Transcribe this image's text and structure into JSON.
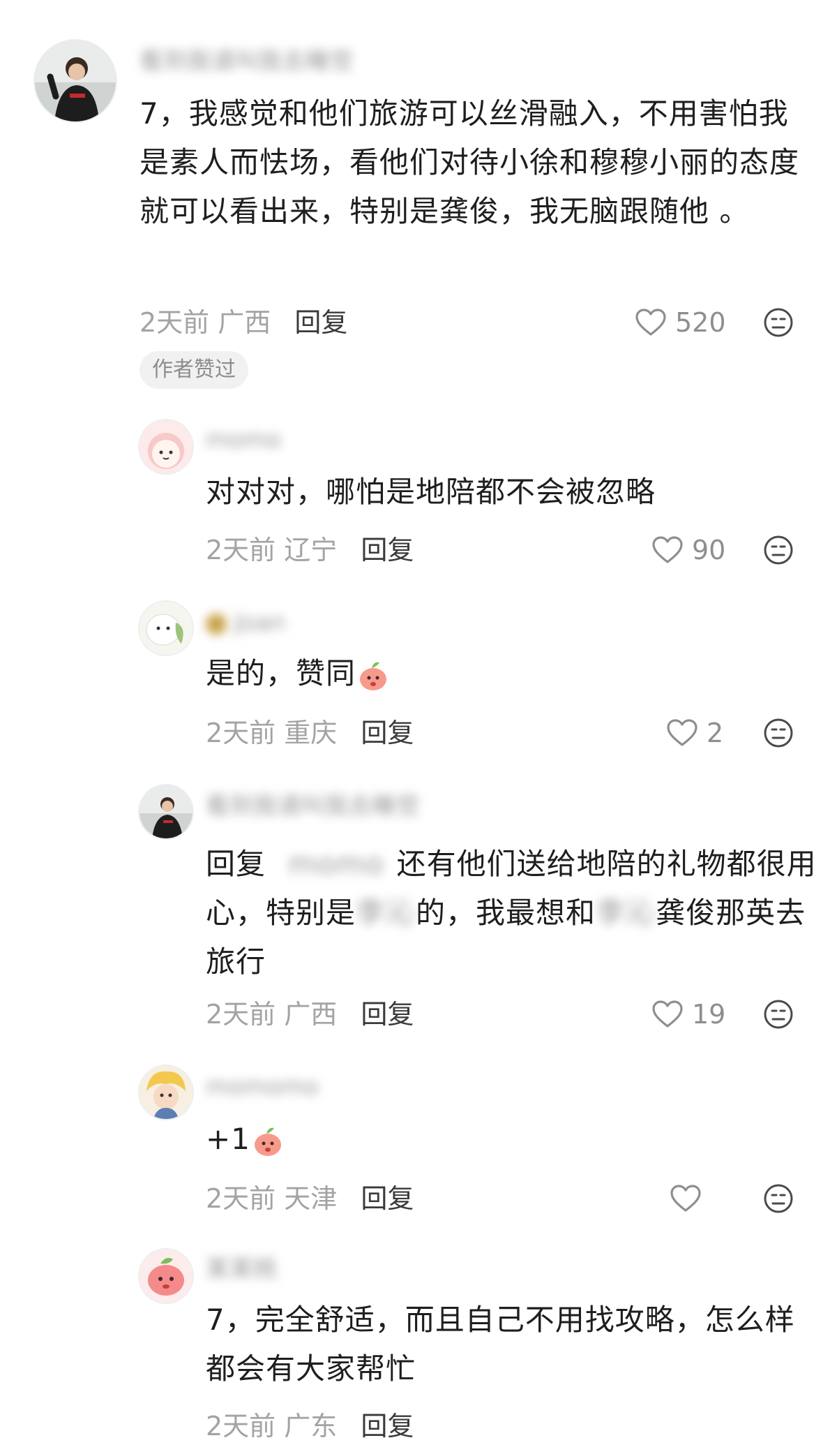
{
  "comments": [
    {
      "username": "看到我请叫我去睡觉",
      "text": "7，我感觉和他们旅游可以丝滑融入，不用害怕我是素人而怯场，看他们对待小徐和穆穆小丽的态度就可以看出来，特别是龚俊，我无脑跟随他 。",
      "time": "2天前",
      "location": "广西",
      "reply_label": "回复",
      "likes": "520",
      "badge": "作者赞过"
    },
    {
      "username": "momo",
      "text": "对对对，哪怕是地陪都不会被忽略",
      "time": "2天前",
      "location": "辽宁",
      "reply_label": "回复",
      "likes": "90"
    },
    {
      "username": "Joan",
      "text": "是的，赞同",
      "time": "2天前",
      "location": "重庆",
      "reply_label": "回复",
      "likes": "2"
    },
    {
      "username": "看到我请叫我去睡觉",
      "reply_prefix": "回复",
      "reply_to": "momo",
      "text_1": "还有他们送给地陪的礼物都很用心，特别是",
      "blurred_name_1": "李沁",
      "text_2": "的，我最想和",
      "blurred_name_2": "李沁",
      "text_3": "龚俊那英去旅行",
      "time": "2天前",
      "location": "广西",
      "reply_label": "回复",
      "likes": "19"
    },
    {
      "username": "momomo",
      "text": "+1",
      "time": "2天前",
      "location": "天津",
      "reply_label": "回复",
      "likes": ""
    },
    {
      "username": "某某桃",
      "text": "7，完全舒适，而且自己不用找攻略，怎么样都会有大家帮忙",
      "time": "2天前",
      "location": "广东",
      "reply_label": "回复"
    }
  ],
  "icons": {
    "like": "heart-outline-icon",
    "more": "dislike-face-icon",
    "reaction": "peach-emoji-icon"
  },
  "colors": {
    "text": "#1e1e1e",
    "meta": "#a3a3a3",
    "reply": "#3a3a3a",
    "badge_bg": "#f1f1f1"
  }
}
